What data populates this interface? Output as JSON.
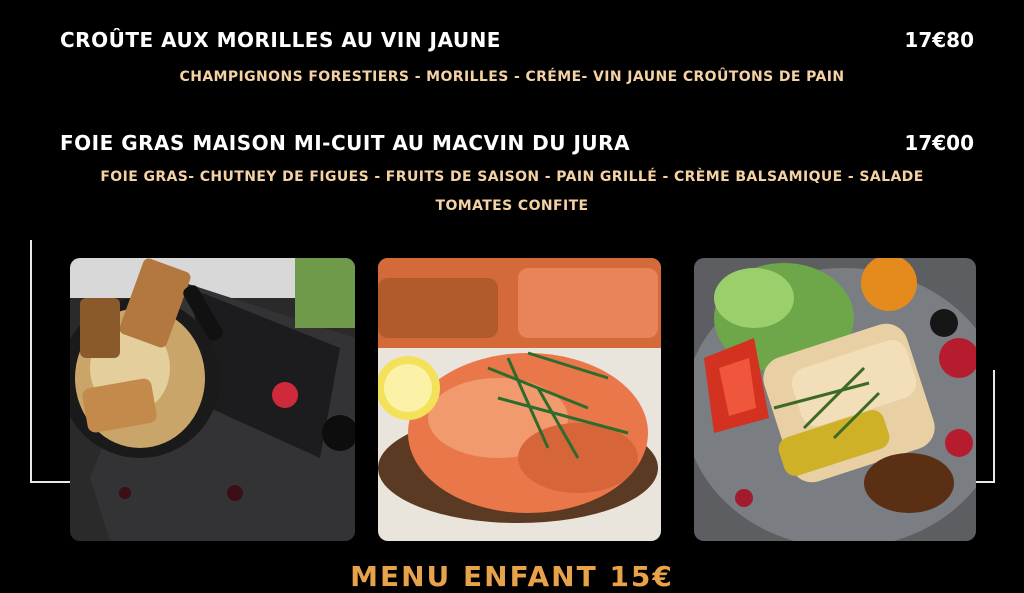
{
  "menu": {
    "items": [
      {
        "name": "CROÛTE AUX MORILLES AU VIN JAUNE",
        "price": "17€80",
        "description": "CHAMPIGNONS FORESTIERS - MORILLES - CRÉME- VIN JAUNE CROÛTONS DE PAIN"
      },
      {
        "name": "FOIE GRAS MAISON MI-CUIT AU MACVIN DU JURA",
        "price": "17€00",
        "description_line1": "FOIE GRAS- CHUTNEY DE FIGUES - FRUITS DE SAISON - PAIN GRILLÉ - CRÈME BALSAMIQUE - SALADE",
        "description_line2": "TOMATES CONFITE"
      }
    ],
    "section_title": "MENU ENFANT 15€"
  },
  "colors": {
    "background": "#000000",
    "item_name": "#ffffff",
    "description": "#f4d2a4",
    "section_title": "#e8a24a"
  }
}
